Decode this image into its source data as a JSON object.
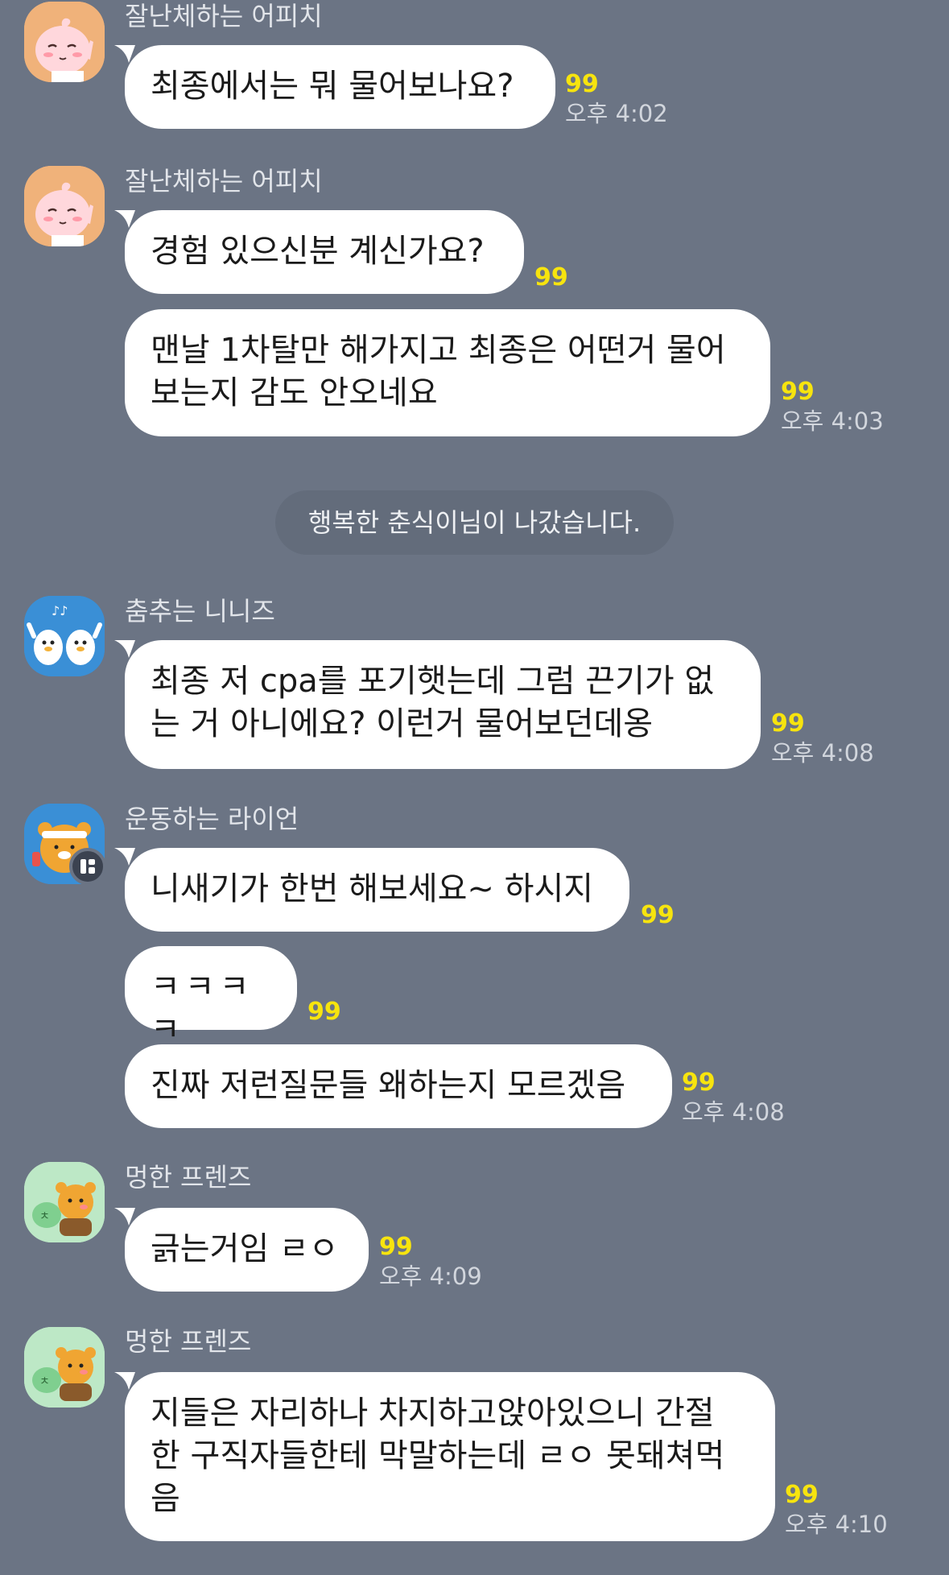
{
  "chat": {
    "messages": [
      {
        "sender": "잘난체하는 어피치",
        "text": "최종에서는 뭐 물어보나요?",
        "unread": "99",
        "time": "오후 4:02"
      },
      {
        "sender": "잘난체하는 어피치",
        "text": "경험 있으신분 계신가요?",
        "unread": "99",
        "time": ""
      },
      {
        "sender": "",
        "text": "맨날 1차탈만 해가지고 최종은 어떤거 물어\n보는지 감도 안오네요",
        "unread": "99",
        "time": "오후 4:03"
      },
      {
        "sender": "춤추는 니니즈",
        "text": "최종 저 cpa를 포기햇는데 그럼 끈기가 없\n는 거 아니에요? 이런거 물어보던데옹",
        "unread": "99",
        "time": "오후 4:08"
      },
      {
        "sender": "운동하는 라이언",
        "text": "니새기가 한번 해보세요~ 하시지",
        "unread": "99",
        "time": ""
      },
      {
        "sender": "",
        "text": "ㅋㅋㅋㅋ",
        "unread": "99",
        "time": ""
      },
      {
        "sender": "",
        "text": "진짜 저런질문들 왜하는지 모르겠음",
        "unread": "99",
        "time": "오후 4:08"
      },
      {
        "sender": "멍한 프렌즈",
        "text": "긁는거임 ㄹㅇ",
        "unread": "99",
        "time": "오후 4:09"
      },
      {
        "sender": "멍한 프렌즈",
        "text": "지들은 자리하나 차지하고앉아있으니 간절\n한 구직자들한테 막말하는데 ㄹㅇ 못돼쳐먹\n음",
        "unread": "99",
        "time": "오후 4:10"
      }
    ],
    "system_notice": "행복한 춘식이님이 나갔습니다.",
    "avatars": [
      "apeach-avatar",
      "apeach-avatar",
      "niniz-avatar",
      "ryan-workout-avatar",
      "friends-avatar",
      "friends-avatar"
    ]
  }
}
